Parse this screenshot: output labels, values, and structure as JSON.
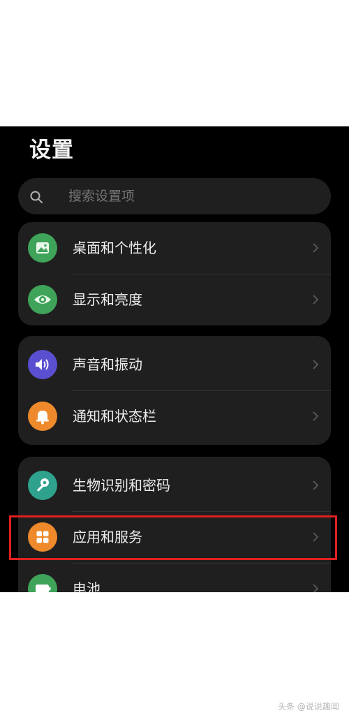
{
  "header": {
    "title": "设置"
  },
  "search": {
    "placeholder": "搜索设置项",
    "icon": "search-icon"
  },
  "groups": [
    {
      "items": [
        {
          "label": "桌面和个性化",
          "icon": "wallpaper-icon",
          "color": "#3fa45a"
        },
        {
          "label": "显示和亮度",
          "icon": "eye-icon",
          "color": "#3fa45a"
        }
      ]
    },
    {
      "items": [
        {
          "label": "声音和振动",
          "icon": "speaker-icon",
          "color": "#5a4fd0"
        },
        {
          "label": "通知和状态栏",
          "icon": "bell-icon",
          "color": "#ee8a2b"
        }
      ]
    },
    {
      "items": [
        {
          "label": "生物识别和密码",
          "icon": "key-icon",
          "color": "#2fa28e"
        },
        {
          "label": "应用和服务",
          "icon": "apps-icon",
          "color": "#ee8a2b"
        },
        {
          "label": "电池",
          "icon": "battery-icon",
          "color": "#3fa45a"
        }
      ]
    }
  ],
  "highlight": {
    "color": "#e02020"
  },
  "watermark": {
    "text": "头条 @说说趣闻"
  }
}
